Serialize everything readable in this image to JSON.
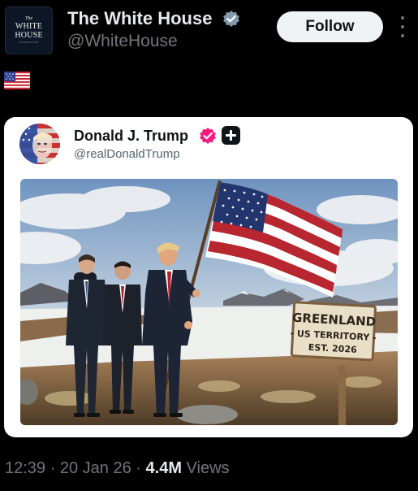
{
  "author": {
    "avatar_text": {
      "the": "The",
      "line1": "WHITE",
      "line2": "HOUSE",
      "small": "WASHINGTON"
    },
    "display_name": "The White House",
    "handle": "@WhiteHouse",
    "verified_badge": "gray-check-badge"
  },
  "follow_button": {
    "label": "Follow"
  },
  "more_icon": "vertical-ellipsis-icon",
  "post_text": {
    "emoji": "us-flag-emoji"
  },
  "quoted_post": {
    "display_name": "Donald J. Trump",
    "handle": "@realDonaldTrump",
    "badges": [
      "pink-check-badge",
      "plus-badge"
    ],
    "image": {
      "sign": {
        "line1": "GREENLAND",
        "line2": "- US TERRITORY -",
        "line3": "EST. 2026"
      }
    }
  },
  "meta": {
    "time": "12:39",
    "sep1": "·",
    "date": "20 Jan 26",
    "sep2": "·",
    "views_count": "4.4M",
    "views_label": "Views"
  },
  "colors": {
    "background": "#000000",
    "primary_text": "#e7e9ea",
    "secondary_text": "#71767b",
    "follow_bg": "#eff3f4",
    "verified_gray": "#829aab",
    "verified_pink": "#f91880"
  }
}
